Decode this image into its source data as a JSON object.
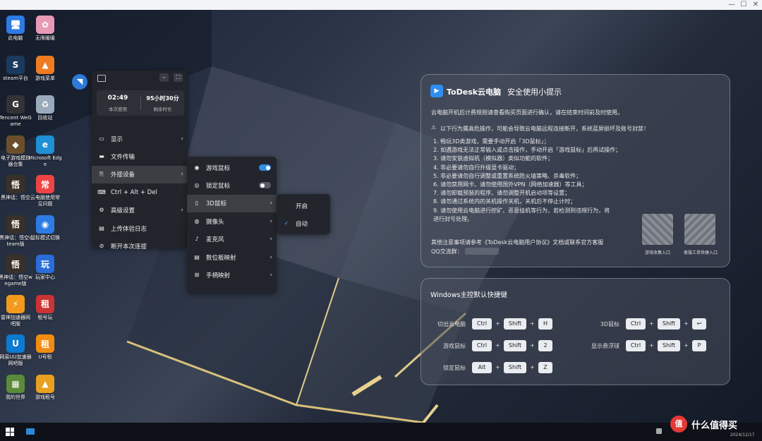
{
  "window": {
    "minimize": "—",
    "maximize": "☐",
    "close": "✕"
  },
  "desktop_icons": [
    {
      "label": "此电脑",
      "icon": "computer-icon",
      "color": "#2d7be5",
      "glyph": "🖥"
    },
    {
      "label": "无限暖暖",
      "icon": "game-icon",
      "color": "#e89ab5",
      "glyph": "✿"
    },
    {
      "label": "steam平台",
      "icon": "steam-icon",
      "color": "#1b3b5e",
      "glyph": "S"
    },
    {
      "label": "游戏菜单",
      "icon": "menu-icon",
      "color": "#ef7b22",
      "glyph": "▲"
    },
    {
      "label": "Tencent WeGame",
      "icon": "wegame-icon",
      "color": "#333",
      "glyph": "G"
    },
    {
      "label": "回收站",
      "icon": "recycle-bin-icon",
      "color": "#9ab",
      "glyph": "♻"
    },
    {
      "label": "电子游戏模拟器合集",
      "icon": "game-icon",
      "color": "#6b4f2c",
      "glyph": "◆"
    },
    {
      "label": "Microsoft Edge",
      "icon": "edge-icon",
      "color": "#1f8fd6",
      "glyph": "e"
    },
    {
      "label": "黑神话：悟空",
      "icon": "game-icon",
      "color": "#3a3028",
      "glyph": "悟"
    },
    {
      "label": "云电脑使用常见问题",
      "icon": "faq-icon",
      "color": "#e44",
      "glyph": "常"
    },
    {
      "label": "黑神话：悟空steam版",
      "icon": "game-icon",
      "color": "#3a3028",
      "glyph": "悟"
    },
    {
      "label": "鼠标模式切换",
      "icon": "mouse-icon",
      "color": "#2d7be5",
      "glyph": "◉"
    },
    {
      "label": "黑神话：悟空wegame版",
      "icon": "game-icon",
      "color": "#3a3028",
      "glyph": "悟"
    },
    {
      "label": "玩家中心",
      "icon": "game-center-icon",
      "color": "#2a6dd8",
      "glyph": "玩"
    },
    {
      "label": "雷神加速器网吧版",
      "icon": "accelerator-icon",
      "color": "#f29a1c",
      "glyph": "⚡"
    },
    {
      "label": "租号玩",
      "icon": "game-icon",
      "color": "#c33",
      "glyph": "租"
    },
    {
      "label": "网易UU加速器网吧版",
      "icon": "uu-icon",
      "color": "#0b7ad1",
      "glyph": "U"
    },
    {
      "label": "U号租",
      "icon": "rent-icon",
      "color": "#f28c10",
      "glyph": "租"
    },
    {
      "label": "我的世界",
      "icon": "minecraft-icon",
      "color": "#5b8b3a",
      "glyph": "▦"
    },
    {
      "label": "游戏租号",
      "icon": "game-icon",
      "color": "#e8a020",
      "glyph": "▲"
    }
  ],
  "menu": {
    "session_time": "02:49",
    "session_label": "本次使用",
    "remaining_time": "95小时30分",
    "remaining_label": "剩余时长",
    "items": [
      {
        "label": "显示",
        "icon": "display-icon",
        "glyph": "▭"
      },
      {
        "label": "文件传输",
        "icon": "folder-icon",
        "glyph": "▬"
      },
      {
        "label": "外接设备",
        "icon": "device-icon",
        "glyph": "⎘"
      },
      {
        "label": "Ctrl + Alt + Del",
        "icon": "keyboard-icon",
        "glyph": "⌨"
      },
      {
        "label": "高级设置",
        "icon": "settings-icon",
        "glyph": "⚙"
      },
      {
        "label": "上传体验日志",
        "icon": "upload-icon",
        "glyph": "▤"
      },
      {
        "label": "断开本次连接",
        "icon": "disconnect-icon",
        "glyph": "⊘"
      }
    ]
  },
  "submenu": {
    "items": [
      {
        "label": "游戏鼠标",
        "icon": "mouse-icon",
        "toggle": true,
        "on": true
      },
      {
        "label": "锁定鼠标",
        "icon": "mouse-lock-icon",
        "toggle": true,
        "on": false
      },
      {
        "label": "3D鼠标",
        "icon": "mouse-3d-icon"
      },
      {
        "label": "摄像头",
        "icon": "camera-icon"
      },
      {
        "label": "麦克风",
        "icon": "microphone-icon"
      },
      {
        "label": "数位板映射",
        "icon": "tablet-icon"
      },
      {
        "label": "手柄映射",
        "icon": "gamepad-icon"
      }
    ],
    "accent": "#2f8ee8"
  },
  "submenu3d": {
    "items": [
      {
        "label": "开启",
        "checked": false
      },
      {
        "label": "自动",
        "checked": true
      }
    ]
  },
  "safety": {
    "brand": "ToDesk云电脑",
    "title": "安全使用小提示",
    "intro": "云电脑开机后计费规则请查看购买页面进行确认，请在结束时间前及时使用。",
    "warning": "以下行为属高危操作，可能会导致云电脑远程连接断开，系统蓝屏损坏及账号封禁！",
    "rules": [
      "1. 畅玩3D类游戏，需要手动开启「3D鼠标」；",
      "2. 如遇游戏无法正常输入或点击操作，手动开启「游戏鼠标」后再试操作；",
      "3. 请勿安装虚拟机（模拟器）类似功能的软件；",
      "4. 非必要请勿自行升级显卡驱动；",
      "5. 非必要请勿自行调整或重置系统防火墙策略、杀毒软件；",
      "6. 请勿禁用网卡、请勿使用国外VPN（网络加速器）等工具；",
      "7. 请勿卸载预装的程序、请勿调整开机启动项等设置；",
      "8. 请勿通过系统内的关机操作关机，关机后不停止计时；",
      "9. 请勿使用云电脑进行挖矿、恶意挂机等行为，若检测到违规行为，将",
      "   进行封号处理。"
    ],
    "footer": "其他注意事项请参考《ToDesk云电脑用户协议》文档或联系官方客服",
    "qq": "QQ交流群：",
    "qr1": "游戏收集入口",
    "qr2": "客服工单快捷入口"
  },
  "shortcuts": {
    "title": "Windows主控默认快捷键",
    "rows": [
      {
        "label": "切出云电脑",
        "keys": [
          "Ctrl",
          "Shift",
          "H"
        ]
      },
      {
        "label": "3D鼠标",
        "keys": [
          "Ctrl",
          "Shift",
          "↩"
        ]
      },
      {
        "label": "游戏鼠标",
        "keys": [
          "Ctrl",
          "Shift",
          "2"
        ]
      },
      {
        "label": "显示悬浮球",
        "keys": [
          "Ctrl",
          "Shift",
          "P"
        ]
      },
      {
        "label": "锁定鼠标",
        "keys": [
          "Alt",
          "Shift",
          "Z"
        ]
      }
    ],
    "plus": "+"
  },
  "taskbar": {
    "date": "2024/12/17",
    "watermark": "什么值得买"
  }
}
